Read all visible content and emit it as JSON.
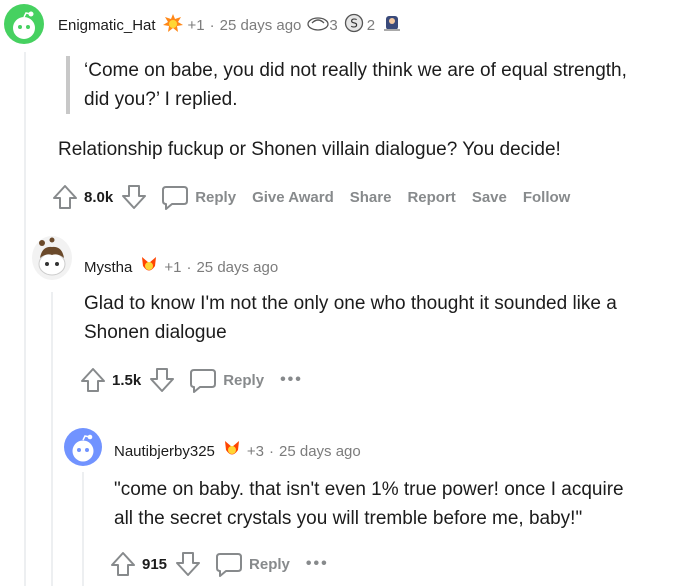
{
  "comments": [
    {
      "username": "Enigmatic_Hat",
      "award_count": "+1",
      "separator": "·",
      "time": "25 days ago",
      "extra_award_1_count": "3",
      "extra_award_2_count": "2",
      "quote_line_1": "‘Come on babe, you did not really think we are of equal strength,",
      "quote_line_2": "did you?’ I replied.",
      "text": "Relationship fuckup or Shonen villain dialogue? You decide!",
      "score": "8.0k",
      "actions": {
        "reply": "Reply",
        "give_award": "Give Award",
        "share": "Share",
        "report": "Report",
        "save": "Save",
        "follow": "Follow"
      }
    },
    {
      "username": "Mystha",
      "award_count": "+1",
      "separator": "·",
      "time": "25 days ago",
      "text_line_1": "Glad to know I'm not the only one who thought it sounded like a",
      "text_line_2": "Shonen dialogue",
      "score": "1.5k",
      "actions": {
        "reply": "Reply",
        "more": "•••"
      }
    },
    {
      "username": "Nautibjerby325",
      "award_count": "+3",
      "separator": "·",
      "time": "25 days ago",
      "text_line_1": "\"come on baby. that isn't even 1% true power! once I acquire",
      "text_line_2": "all the secret crystals you will tremble before me, baby!\"",
      "score": "915",
      "actions": {
        "reply": "Reply",
        "more": "•••"
      }
    }
  ],
  "colors": {
    "vote_icon": "#878a8c",
    "thread_line": "#edeff1",
    "quote_bar": "#c8c8c8",
    "avatar_green": "#46d160",
    "avatar_blue": "#7193ff"
  }
}
